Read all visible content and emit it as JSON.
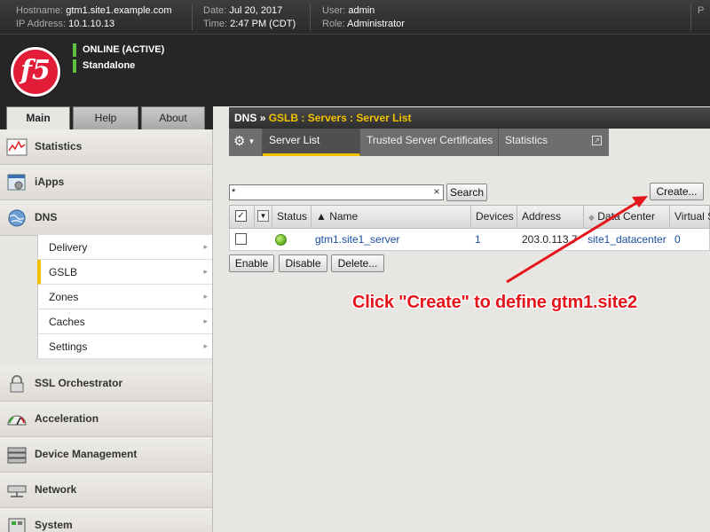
{
  "header": {
    "hostname_label": "Hostname:",
    "hostname": "gtm1.site1.example.com",
    "ip_label": "IP Address:",
    "ip": "10.1.10.13",
    "date_label": "Date:",
    "date": "Jul 20, 2017",
    "time_label": "Time:",
    "time": "2:47 PM (CDT)",
    "user_label": "User:",
    "user": "admin",
    "role_label": "Role:",
    "role": "Administrator",
    "corner_mark": "P"
  },
  "brand": {
    "logo_text": "f5",
    "status_primary": "ONLINE (ACTIVE)",
    "status_secondary": "Standalone",
    "status_color": "#5fc23f"
  },
  "tabs": [
    {
      "label": "Main",
      "active": true
    },
    {
      "label": "Help",
      "active": false
    },
    {
      "label": "About",
      "active": false
    }
  ],
  "nav": {
    "items": [
      {
        "label": "Statistics",
        "icon": "statistics-icon"
      },
      {
        "label": "iApps",
        "icon": "iapps-icon"
      },
      {
        "label": "DNS",
        "icon": "dns-globe-icon"
      },
      {
        "label": "SSL Orchestrator",
        "icon": "lock-icon"
      },
      {
        "label": "Acceleration",
        "icon": "speedometer-icon"
      },
      {
        "label": "Device Management",
        "icon": "device-icon"
      },
      {
        "label": "Network",
        "icon": "network-icon"
      },
      {
        "label": "System",
        "icon": "system-icon"
      }
    ],
    "dns_sub": [
      {
        "label": "Delivery",
        "selected": false
      },
      {
        "label": "GSLB",
        "selected": true
      },
      {
        "label": "Zones",
        "selected": false
      },
      {
        "label": "Caches",
        "selected": false
      },
      {
        "label": "Settings",
        "selected": false
      }
    ]
  },
  "breadcrumb": {
    "root": "DNS",
    "separator": "»",
    "path": "GSLB : Servers : Server List"
  },
  "section_tabs": [
    {
      "label": "Server List",
      "active": true
    },
    {
      "label": "Trusted Server Certificates",
      "active": false
    },
    {
      "label": "Statistics",
      "active": false
    }
  ],
  "search": {
    "value": "*",
    "clear": "×",
    "button": "Search"
  },
  "create_button": "Create...",
  "table": {
    "columns": [
      "Status",
      "▲ Name",
      "Devices",
      "Address",
      "Data Center",
      "Virtual S"
    ],
    "rows": [
      {
        "status": "available",
        "name": "gtm1.site1_server",
        "devices": "1",
        "address": "203.0.113.7",
        "data_center": "site1_datacenter",
        "virtual_servers": "0"
      }
    ]
  },
  "actions": {
    "enable": "Enable",
    "disable": "Disable",
    "delete": "Delete..."
  },
  "annotation": {
    "text": "Click \"Create\" to define gtm1.site2",
    "color": "#e4161b"
  }
}
